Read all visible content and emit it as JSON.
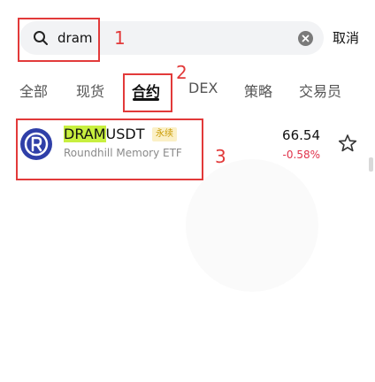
{
  "search": {
    "query": "dram",
    "placeholder": ""
  },
  "cancel_label": "取消",
  "tabs": [
    {
      "label": "全部"
    },
    {
      "label": "现货"
    },
    {
      "label": "合约",
      "active": true
    },
    {
      "label": "DEX"
    },
    {
      "label": "策略"
    },
    {
      "label": "交易员"
    }
  ],
  "result": {
    "symbol_highlight": "DRAM",
    "symbol_rest": "USDT",
    "badge": "永续",
    "name": "Roundhill Memory ETF",
    "price": "66.54",
    "change": "-0.58%"
  },
  "annotations": {
    "one": "1",
    "two": "2",
    "three": "3"
  },
  "colors": {
    "annotation": "#e23a3a",
    "highlight": "#c8ef3f",
    "negative": "#e0324b",
    "coin_icon": "#2f3fa8",
    "badge_bg": "#fbf0c6",
    "badge_text": "#c99a00"
  },
  "icons": [
    "search-icon",
    "clear-icon",
    "star-icon",
    "coin-icon"
  ]
}
